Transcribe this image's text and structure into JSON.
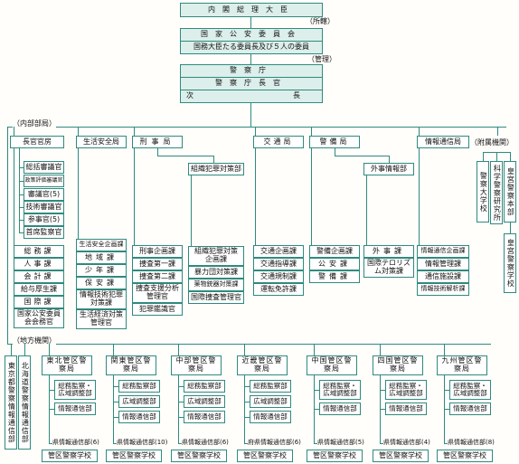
{
  "top": {
    "pm": "内閣総理大臣",
    "shokan": "（所轄）",
    "commission": "国家公安委員会",
    "commission_sub": "国務大臣たる委員長及び５人の委員",
    "kanri": "（管理）",
    "npa": "警察庁",
    "commissioner": "警察庁長官",
    "deputy": "次長"
  },
  "sections": {
    "internal": "（内部部局）",
    "regional": "（地方機関）",
    "attached": "（附属機関）"
  },
  "bureaus": {
    "chokan": {
      "title": "長官官房",
      "sub": [
        "総括審議官",
        "政策評価審議官",
        "審議官(5)",
        "技術審議官",
        "参事官(5)",
        "首席監察官"
      ],
      "divs": [
        "総務課",
        "人事課",
        "会計課",
        "給与厚生課",
        "国際課",
        "国家公安委員会会務官"
      ]
    },
    "seian": {
      "title": "生活安全局",
      "divs": [
        "生活安全企画課",
        "地域課",
        "少年課",
        "保安課",
        "情報技術犯罪対策課",
        "生活経済対策管理官"
      ]
    },
    "keiji": {
      "title": "刑事局",
      "divs": [
        "刑事企画課",
        "捜査第一課",
        "捜査第二課",
        "捜査支援分析管理官",
        "犯罪鑑識官"
      ],
      "sub_dept": "組織犯罪対策部",
      "sub_divs": [
        "組織犯罪対策企画課",
        "暴力団対策課",
        "薬物銃器対策課",
        "国際捜査管理官"
      ]
    },
    "kotsu": {
      "title": "交通局",
      "divs": [
        "交通企画課",
        "交通指導課",
        "交通規制課",
        "運転免許課"
      ]
    },
    "keibi": {
      "title": "警備局",
      "divs": [
        "警備企画課",
        "公安課",
        "警備課"
      ],
      "sub_dept": "外事情報部",
      "sub_divs": [
        "外事課",
        "国際テロリズム対策課"
      ]
    },
    "joho": {
      "title": "情報通信局",
      "divs": [
        "情報通信企画課",
        "情報管理課",
        "通信施設課",
        "情報技術解析課"
      ]
    }
  },
  "attached": [
    "警察大学校",
    "科学警察研究所",
    "皇宮警察本部",
    "皇宮警察学校"
  ],
  "regional": {
    "tokyo": "東京都警察情報通信部",
    "hokkaido": "北海道警察情報通信部",
    "bureaus": [
      {
        "name": "東北管区警察局",
        "divs": [
          "総務監察・広域調整部",
          "情報通信部"
        ],
        "prefs": "県情報通信部(6)",
        "school": "管区警察学校"
      },
      {
        "name": "関東管区警察局",
        "divs": [
          "総務監察部",
          "広域調整部",
          "情報通信部"
        ],
        "prefs": "県情報通信部(10)",
        "school": "管区警察学校"
      },
      {
        "name": "中部管区警察局",
        "divs": [
          "総務監察部",
          "広域調整部",
          "情報通信部"
        ],
        "prefs": "県情報通信部(6)",
        "school": "管区警察学校"
      },
      {
        "name": "近畿管区警察局",
        "divs": [
          "総務監察部",
          "広域調整部",
          "情報通信部"
        ],
        "prefs": "府県情報通信部(6)",
        "school": "管区警察学校"
      },
      {
        "name": "中国管区警察局",
        "divs": [
          "総務監察・広域調整部",
          "情報通信部"
        ],
        "prefs": "県情報通信部(5)",
        "school": "管区警察学校"
      },
      {
        "name": "四国管区警察局",
        "divs": [
          "総務監察・広域調整部",
          "情報通信部"
        ],
        "prefs": "県情報通信部(4)",
        "school": "管区警察学校"
      },
      {
        "name": "九州管区警察局",
        "divs": [
          "総務監察・広域調整部",
          "情報通信部"
        ],
        "prefs": "県情報通信部(8)",
        "school": "管区警察学校"
      }
    ]
  }
}
